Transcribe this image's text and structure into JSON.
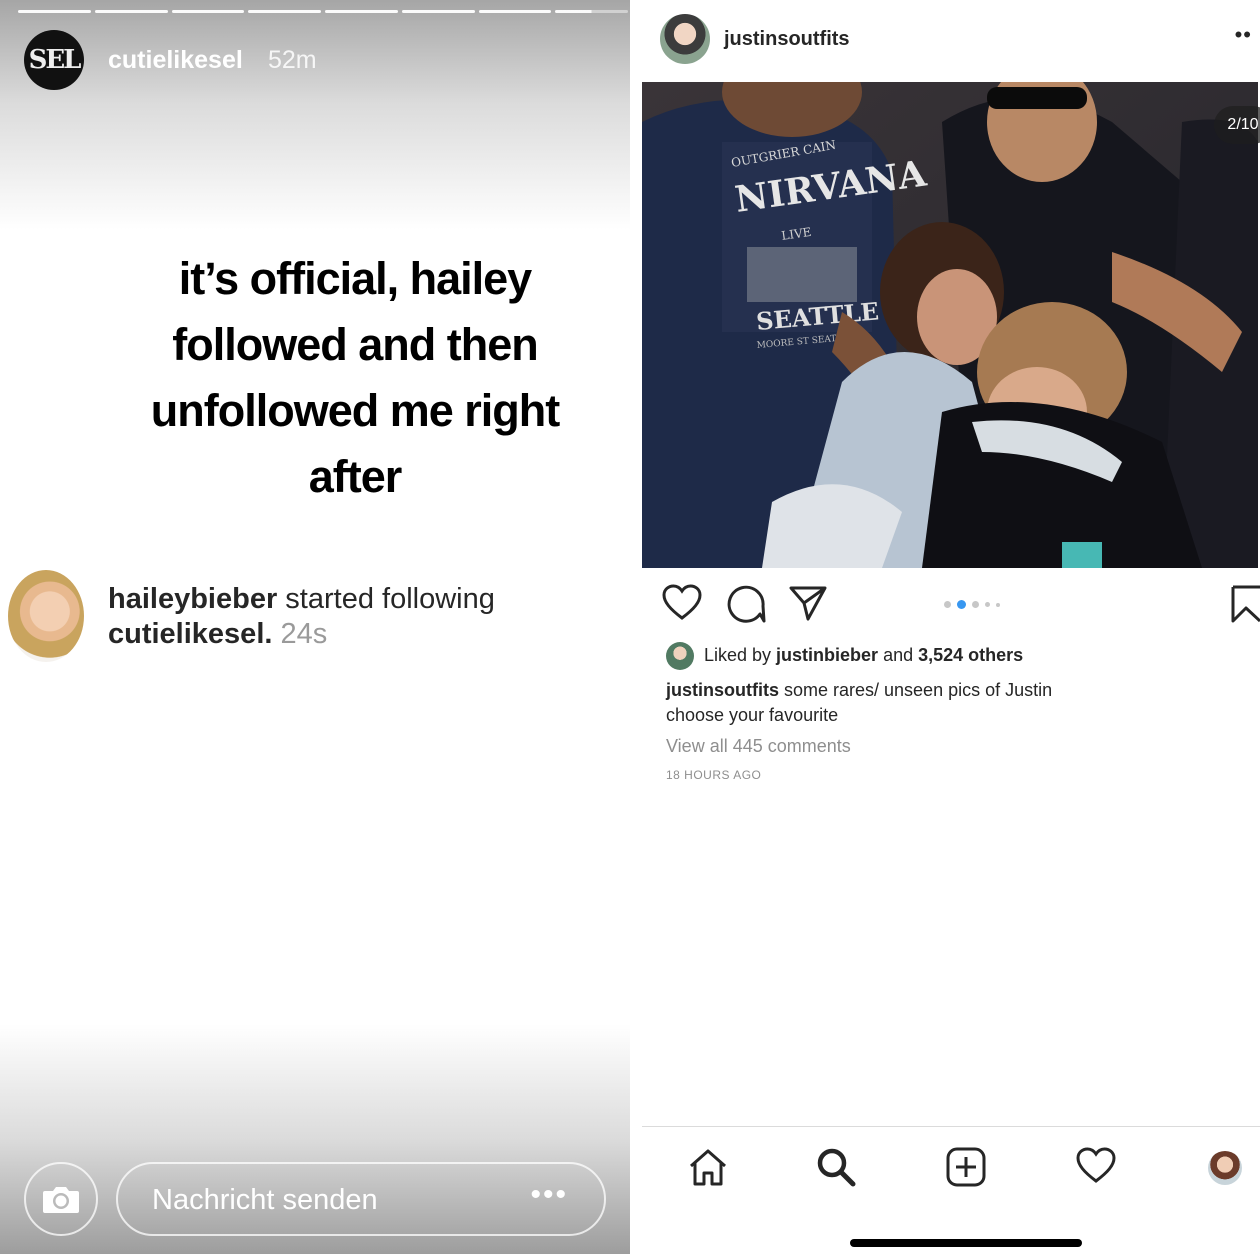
{
  "story": {
    "avatar_text": "SEL",
    "username": "cutielikesel",
    "time": "52m",
    "progress_segments": 8,
    "progress_current": 8,
    "main_text": [
      "it’s official, hailey",
      "followed and then",
      "unfollowed me right",
      "after"
    ],
    "notification": {
      "user": "haileybieber",
      "action": " started following ",
      "target": "cutielikesel.",
      "time": " 24s"
    },
    "reply_placeholder": "Nachricht senden",
    "more": "•••",
    "icons": [
      "camera-icon",
      "more-dots-icon"
    ]
  },
  "post": {
    "username": "justinsoutfits",
    "more": "••",
    "photo_counter": "2/10",
    "carousel": {
      "total_dots": 5,
      "active_index": 1
    },
    "liked_by_prefix": "Liked by ",
    "liked_by_user": "justinbieber",
    "liked_by_and": " and ",
    "liked_by_count": "3,524 others",
    "caption_user": "justinsoutfits",
    "caption_line1": " some rares/ unseen pics of Justin",
    "caption_line2": "choose your favourite",
    "view_all": "View all 445 comments",
    "timestamp": "18 HOURS AGO",
    "photo_text": {
      "shirt_top": "OUTGRIER CAIN",
      "shirt_band": "NIRVANA",
      "shirt_live": "LIVE",
      "shirt_city": "SEATTLE",
      "shirt_small": "MOORE ST SEATTLE"
    },
    "colors": {
      "accent": "#3897f0",
      "text": "#262626",
      "muted": "#8e8e8e"
    },
    "icons": [
      "heart-icon",
      "comment-icon",
      "share-icon",
      "bookmark-icon",
      "home-icon",
      "search-icon",
      "add-icon",
      "activity-heart-icon"
    ]
  }
}
